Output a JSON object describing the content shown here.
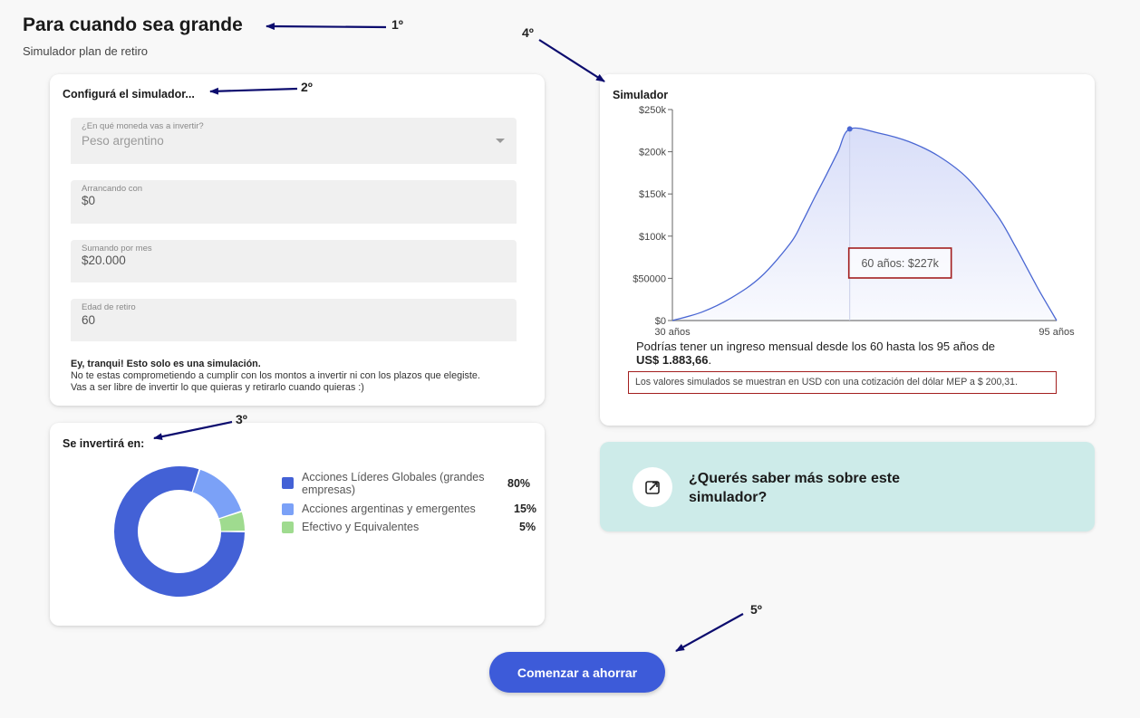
{
  "header": {
    "title": "Para cuando sea grande",
    "subtitle": "Simulador plan de retiro"
  },
  "config": {
    "title": "Configurá el simulador...",
    "currency": {
      "label": "¿En qué moneda vas a invertir?",
      "value": "Peso argentino",
      "disabled": true
    },
    "start": {
      "label": "Arrancando con",
      "value": "$0"
    },
    "monthly": {
      "label": "Sumando por mes",
      "value": "$20.000"
    },
    "retirement_age": {
      "label": "Edad de retiro",
      "value": "60"
    },
    "note_title": "Ey, tranqui! Esto solo es una simulación.",
    "note_line1": "No te estas comprometiendo a cumplir con los montos a invertir ni con los plazos que elegiste.",
    "note_line2": "Vas a ser libre de invertir lo que quieras y retirarlo cuando quieras :)"
  },
  "allocation": {
    "title": "Se invertirá en:",
    "items": [
      {
        "label": "Acciones Líderes Globales (grandes empresas)",
        "pct": "80%",
        "value": 80,
        "color": "#4361d6"
      },
      {
        "label": "Acciones argentinas y emergentes",
        "pct": "15%",
        "value": 15,
        "color": "#7ba1f7"
      },
      {
        "label": "Efectivo y Equivalentes",
        "pct": "5%",
        "value": 5,
        "color": "#9fdb8f"
      }
    ]
  },
  "simulator": {
    "title": "Simulador",
    "result_text": "Podrías tener un ingreso mensual desde los 60 hasta los 95 años de",
    "result_amount": "US$ 1.883,66",
    "result_end": ".",
    "note": "Los valores simulados se muestran en USD con una cotización del dólar MEP a $ 200,31."
  },
  "chart_data": {
    "type": "area",
    "x_tick_labels": [
      "30 años",
      "95 años"
    ],
    "y_tick_labels": [
      "$0",
      "$50000",
      "$100k",
      "$150k",
      "$200k",
      "$250k"
    ],
    "y_ticks": [
      0,
      50000,
      100000,
      150000,
      200000,
      250000
    ],
    "xlim": [
      30,
      95
    ],
    "ylim": [
      0,
      250000
    ],
    "x": [
      30,
      35,
      40,
      45,
      50,
      52,
      54,
      56,
      58,
      60,
      65,
      70,
      75,
      80,
      85,
      88,
      90,
      92,
      94,
      95
    ],
    "y": [
      0,
      10000,
      27000,
      52000,
      92000,
      117000,
      145000,
      172000,
      200000,
      227000,
      222000,
      212000,
      195000,
      168000,
      124000,
      88000,
      62000,
      36000,
      12000,
      0
    ],
    "highlight": {
      "x": 60,
      "y": 227000,
      "label": "60 años: $227k"
    },
    "line_color": "#4a67d3",
    "fill_color": "#d6dcf8"
  },
  "info_card": {
    "text": "¿Querés saber más sobre este simulador?",
    "icon": "external-link-icon"
  },
  "cta": {
    "label": "Comenzar a ahorrar"
  },
  "annotations": [
    "1º",
    "2º",
    "3º",
    "4º",
    "5º"
  ]
}
